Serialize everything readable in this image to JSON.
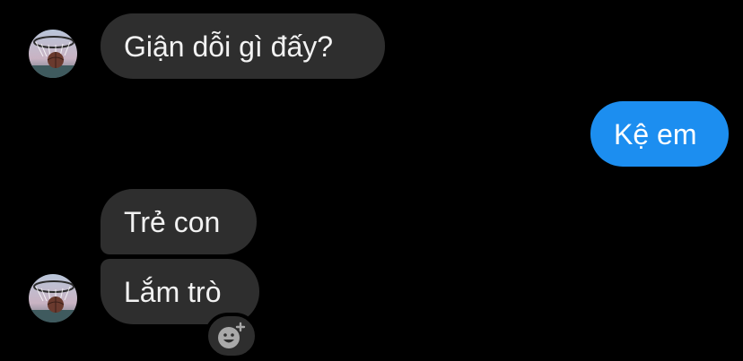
{
  "chat": {
    "messages": [
      {
        "direction": "incoming",
        "text": "Giận dỗi gì đấy?"
      },
      {
        "direction": "outgoing",
        "text": "Kệ em"
      },
      {
        "direction": "incoming",
        "text": "Trẻ con"
      },
      {
        "direction": "incoming",
        "text": "Lắm trò"
      }
    ],
    "reaction_button": {
      "icon": "add-reaction-smiley-icon"
    }
  },
  "colors": {
    "background": "#000000",
    "incoming_bubble": "#2e2e2e",
    "outgoing_bubble": "#1c8ef0",
    "text": "#f2f2f2"
  }
}
